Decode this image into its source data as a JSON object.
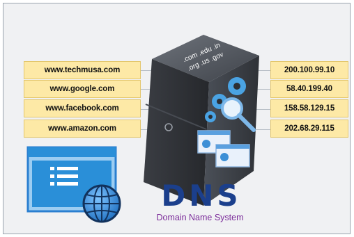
{
  "domains": [
    {
      "name": "www.techmusa.com",
      "ip": "200.100.99.10"
    },
    {
      "name": "www.google.com",
      "ip": "58.40.199.40"
    },
    {
      "name": "www.facebook.com",
      "ip": "158.58.129.15"
    },
    {
      "name": "www.amazon.com",
      "ip": "202.68.29.115"
    }
  ],
  "server": {
    "tld_line1": ".com .edu .in",
    "tld_line2": ".org .us .gov"
  },
  "logo": {
    "title": "DNS",
    "subtitle": "Domain Name System"
  },
  "colors": {
    "box_fill": "#fde9a6",
    "server_dark": "#2c2f34",
    "accent_blue": "#2a8fd8",
    "dns_blue": "#1b3f8c",
    "subtitle_purple": "#7a2a99"
  },
  "icons": [
    "gear-icon",
    "magnifier-icon",
    "browser-window-icon",
    "globe-icon"
  ]
}
